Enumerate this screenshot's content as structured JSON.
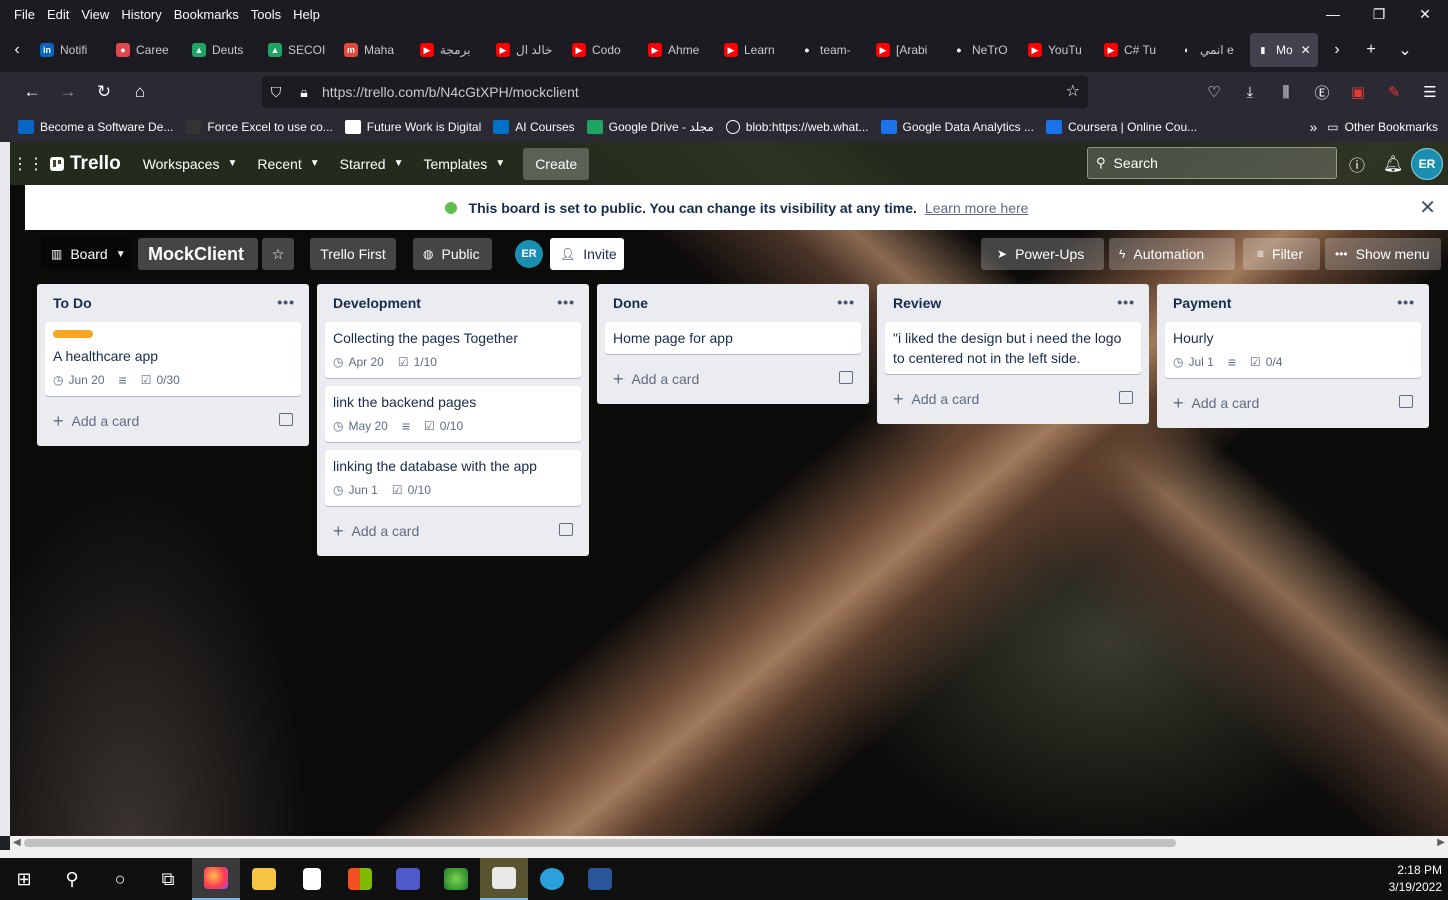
{
  "browser": {
    "menu": [
      "File",
      "Edit",
      "View",
      "History",
      "Bookmarks",
      "Tools",
      "Help"
    ],
    "tabs": [
      {
        "label": "Notifi",
        "color": "#0a66c2",
        "glyph": "in"
      },
      {
        "label": "Caree",
        "color": "#e2474b",
        "glyph": "●"
      },
      {
        "label": "Deuts",
        "color": "#1fa463",
        "glyph": "▲"
      },
      {
        "label": "SECOI",
        "color": "#1fa463",
        "glyph": "▲"
      },
      {
        "label": "Maha",
        "color": "#e24b3b",
        "glyph": "m"
      },
      {
        "label": "برمجة",
        "color": "#ff0000",
        "glyph": "▶"
      },
      {
        "label": "خالد ال",
        "color": "#ff0000",
        "glyph": "▶"
      },
      {
        "label": "Codo",
        "color": "#ff0000",
        "glyph": "▶"
      },
      {
        "label": "Ahme",
        "color": "#ff0000",
        "glyph": "▶"
      },
      {
        "label": "Learn",
        "color": "#ff0000",
        "glyph": "▶"
      },
      {
        "label": "team-",
        "color": "#ffffff",
        "glyph": "●"
      },
      {
        "label": "[Arabi",
        "color": "#ff0000",
        "glyph": "▶"
      },
      {
        "label": "NeTrO",
        "color": "#ffffff",
        "glyph": "●"
      },
      {
        "label": "YouTu",
        "color": "#ff0000",
        "glyph": "▶"
      },
      {
        "label": "C# Tu",
        "color": "#ff0000",
        "glyph": "▶"
      },
      {
        "label": "انمي e",
        "color": "#ffffff",
        "glyph": "◐"
      },
      {
        "label": "Mo",
        "color": "#ffffff",
        "glyph": "▮"
      }
    ],
    "url": "https://trello.com/b/N4cGtXPH/mockclient",
    "bookmarks": [
      "Become a Software De...",
      "Force Excel to use co...",
      "Future Work is Digital",
      "AI Courses",
      "Google Drive - مجلد",
      "blob:https://web.what...",
      "Google Data Analytics ...",
      "Coursera | Online Cou..."
    ],
    "other_bookmarks": "Other Bookmarks"
  },
  "trello": {
    "logo": "Trello",
    "nav": [
      "Workspaces",
      "Recent",
      "Starred",
      "Templates"
    ],
    "create": "Create",
    "search_placeholder": "Search",
    "user_initials": "ER",
    "banner": {
      "message": "This board is set to public. You can change its visibility at any time.",
      "link": "Learn more here"
    },
    "boardbar": {
      "view": "Board",
      "title": "MockClient",
      "workspace": "Trello First",
      "visibility": "Public",
      "invite": "Invite",
      "powerups": "Power-Ups",
      "automation": "Automation",
      "filter": "Filter",
      "show_menu": "Show menu"
    },
    "add_card": "Add a card",
    "lists": [
      {
        "name": "To Do",
        "cards": [
          {
            "title": "A healthcare app",
            "label": true,
            "date": "Jun 20",
            "desc": true,
            "check": "0/30"
          }
        ]
      },
      {
        "name": "Development",
        "cards": [
          {
            "title": "Collecting the pages Together",
            "date": "Apr 20",
            "desc": false,
            "check": "1/10"
          },
          {
            "title": "link the backend pages",
            "date": "May 20",
            "desc": true,
            "check": "0/10"
          },
          {
            "title": "linking the database with the app",
            "date": "Jun 1",
            "desc": false,
            "check": "0/10"
          }
        ]
      },
      {
        "name": "Done",
        "cards": [
          {
            "title": "Home page for app"
          }
        ]
      },
      {
        "name": "Review",
        "cards": [
          {
            "title": "\"i liked the design but i need the logo to centered not in the left side."
          }
        ]
      },
      {
        "name": "Payment",
        "cards": [
          {
            "title": "Hourly",
            "date": "Jul 1",
            "desc": true,
            "check": "0/4"
          }
        ]
      }
    ]
  },
  "taskbar": {
    "time": "2:18 PM",
    "date": "3/19/2022"
  }
}
